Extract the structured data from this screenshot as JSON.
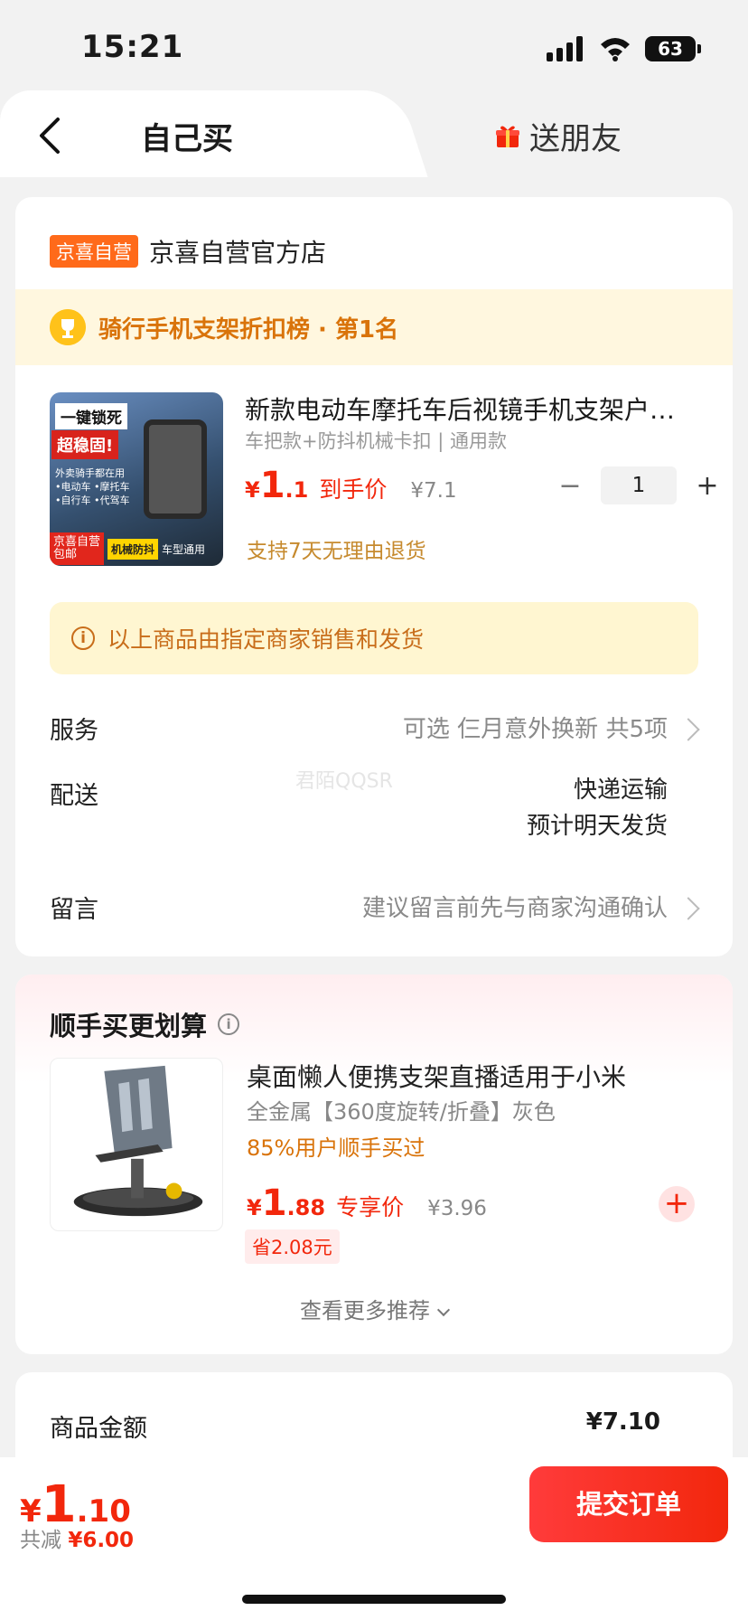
{
  "status_bar": {
    "time": "15:21",
    "battery": "63"
  },
  "tabs": {
    "self": "自己买",
    "gift": "送朋友"
  },
  "store": {
    "badge": "京喜自营",
    "name": "京喜自营官方店",
    "rank_text": "骑行手机支架折扣榜 · 第1名"
  },
  "product": {
    "image_tags": {
      "t1": "一键锁死",
      "t2": "超稳固!",
      "t3": "外卖骑手都在用",
      "t4": "•电动车 •摩托车",
      "t5": "•自行车 •代驾车",
      "b1": "京喜自营",
      "b2": "包邮",
      "b3": "机械防抖",
      "b4": "车型通用"
    },
    "title": "新款电动车摩托车后视镜手机支架户外骑行导航",
    "spec": "车把款+防抖机械卡扣 | 通用款",
    "price_symbol": "¥",
    "price_int": "1",
    "price_dec": ".1",
    "price_label": "到手价",
    "orig_price": "¥7.1",
    "quantity": "1",
    "minus": "−",
    "plus": "+",
    "return_policy": "支持7天无理由退货"
  },
  "notice": {
    "icon": "i",
    "text": "以上商品由指定商家销售和发货"
  },
  "rows": {
    "service_label": "服务",
    "service_value": "可选 仨月意外换新 共5项",
    "delivery_label": "配送",
    "delivery_value1": "快递运输",
    "delivery_value2": "预计明天发货",
    "message_label": "留言",
    "message_value": "建议留言前先与商家沟通确认"
  },
  "watermark": "君陌QQSR",
  "recommend": {
    "title": "顺手买更划算",
    "name": "桌面懒人便携支架直播适用于小米",
    "spec": "全金属【360度旋转/折叠】灰色",
    "bought": "85%用户顺手买过",
    "price_symbol": "¥",
    "price_int": "1",
    "price_dec": ".88",
    "price_label": "专享价",
    "orig_price": "¥3.96",
    "save": "省2.08元",
    "add": "+",
    "more": "查看更多推荐"
  },
  "amount": {
    "label": "商品金额",
    "value": "¥7.10"
  },
  "bottom": {
    "symbol": "¥",
    "int": "1",
    "dec": ".10",
    "saved_label": "共减",
    "saved_value": "¥6.00",
    "submit": "提交订单"
  },
  "colors": {
    "accent": "#f2270c",
    "orange": "#d9730a",
    "badge": "#ff6a1a"
  }
}
